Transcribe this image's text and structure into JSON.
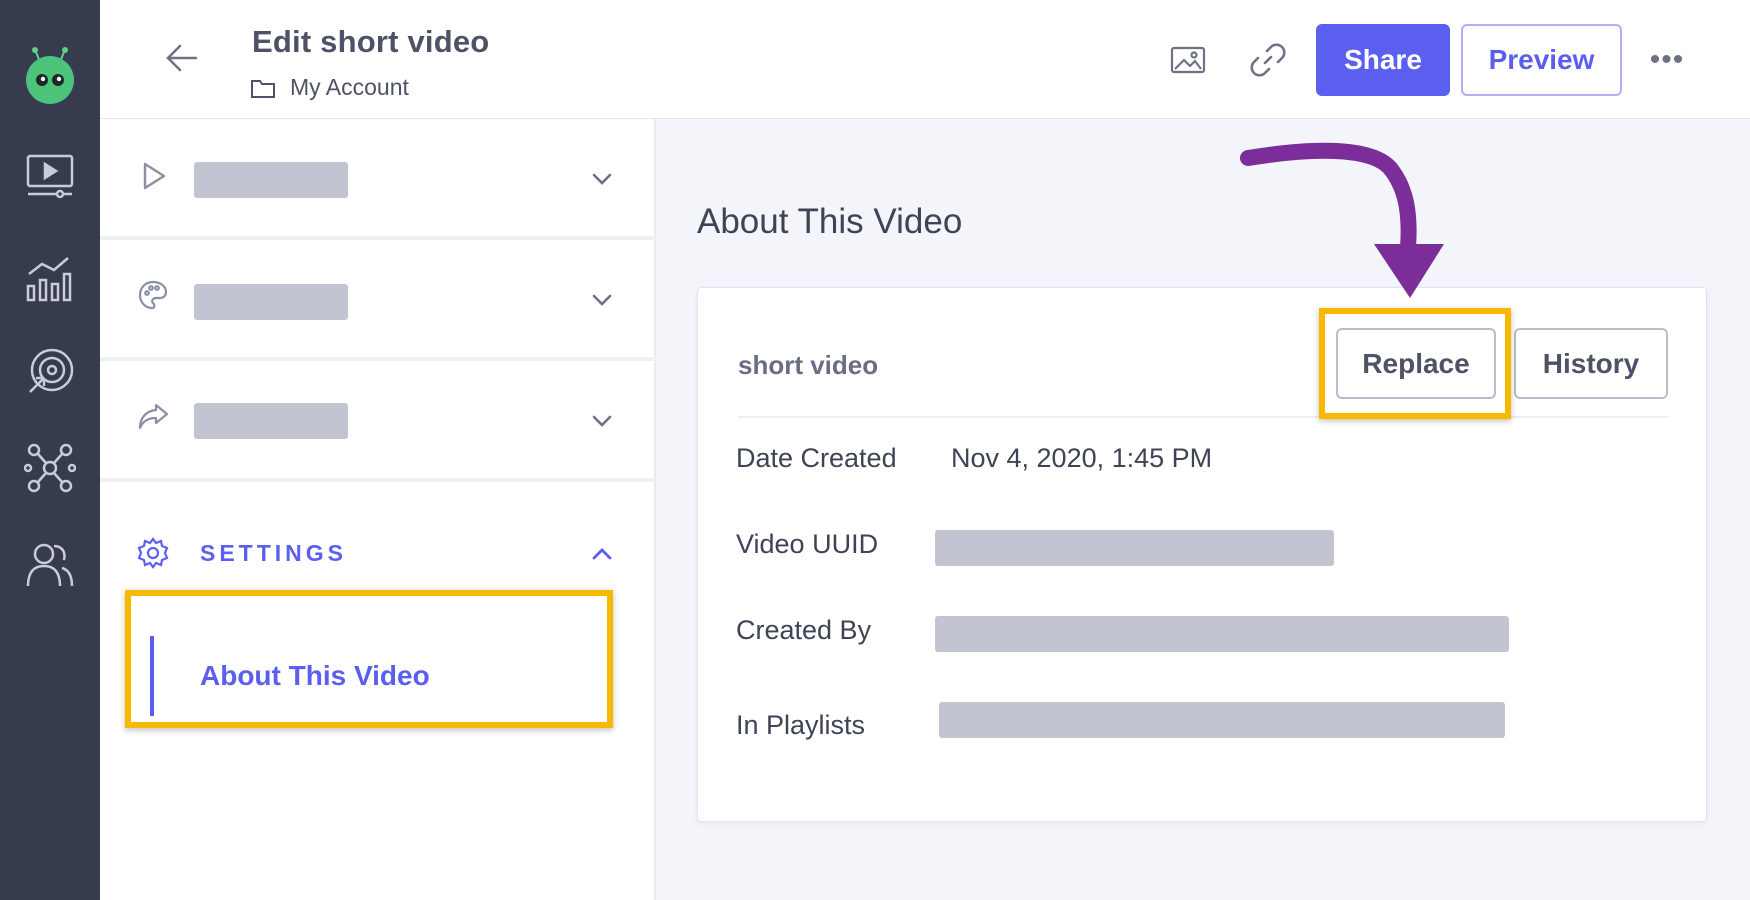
{
  "header": {
    "title": "Edit short video",
    "breadcrumb": "My Account",
    "share_label": "Share",
    "preview_label": "Preview",
    "icons": [
      "arrow-left-icon",
      "image-icon",
      "link-icon",
      "more-icon"
    ]
  },
  "rail": {
    "icons": [
      "logo-icon",
      "video-library-icon",
      "analytics-icon",
      "target-icon",
      "integrations-icon",
      "users-icon"
    ]
  },
  "sidebar": {
    "sections": [
      {
        "icon": "play-icon"
      },
      {
        "icon": "palette-icon"
      },
      {
        "icon": "share-arrow-icon"
      }
    ],
    "settings_label": "SETTINGS",
    "active_item": "About This Video"
  },
  "main": {
    "heading": "About This Video",
    "file_name": "short video",
    "replace_label": "Replace",
    "history_label": "History",
    "rows": [
      {
        "label": "Date Created",
        "value": "Nov 4, 2020, 1:45 PM"
      },
      {
        "label": "Video UUID"
      },
      {
        "label": "Created By"
      },
      {
        "label": "In Playlists"
      }
    ]
  },
  "colors": {
    "accent": "#5b5ff0",
    "rail": "#363b4e",
    "highlight": "#f7b800",
    "arrow": "#7b2d9a",
    "redacted": "#c2c4d2"
  }
}
